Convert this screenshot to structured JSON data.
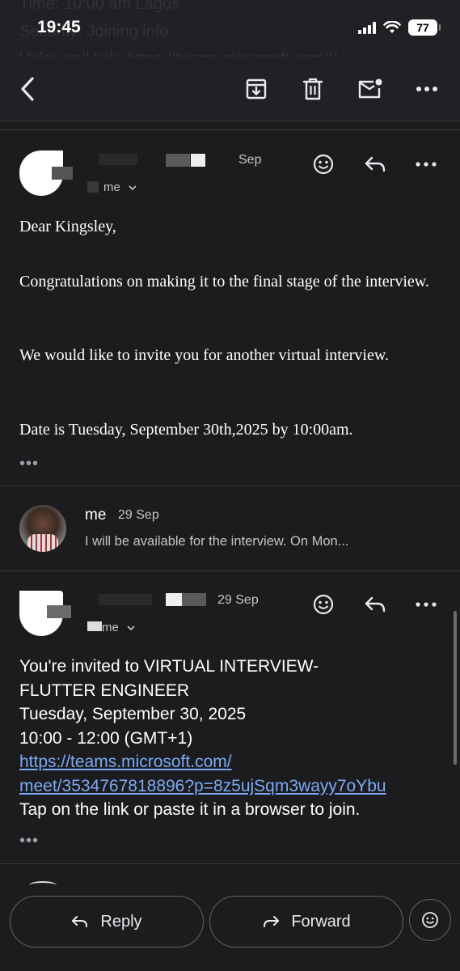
{
  "status_bar": {
    "time": "19:45",
    "battery": "77",
    "ghost_lines": [
      "Time: 10:00 am Lagos",
      "Security: Joining info",
      "Video call link: https://teams.microsoft.com/l/"
    ]
  },
  "toolbar": {
    "icons": [
      "back-arrow-icon",
      "archive-icon",
      "trash-icon",
      "mark-unread-icon",
      "more-icon"
    ]
  },
  "message_1": {
    "date": "Sep",
    "to": "me",
    "greeting": "Dear Kingsley,",
    "paragraph_1": "Congratulations on making it to the final stage of the interview.",
    "paragraph_2": "We would like to invite you for another virtual interview.",
    "paragraph_3": "Date is Tuesday, September 30th,2025 by 10:00am.",
    "more": "•••"
  },
  "message_2": {
    "sender": "me",
    "date": "29 Sep",
    "snippet": "I will be available for the interview. On Mon..."
  },
  "message_3": {
    "date": "29 Sep",
    "to": "me",
    "line_1": "You're invited to VIRTUAL INTERVIEW-",
    "line_2": "FLUTTER ENGINEER",
    "line_3": "Tuesday, September 30, 2025",
    "line_4": "10:00 - 12:00 (GMT+1)",
    "link_line_1": "https://teams.microsoft.com/",
    "link_line_2": "meet/3534767818896?p=8z5ujSqm3wayy7oYbu",
    "line_5": "Tap on the link or paste it in a browser to join.",
    "more": "•••"
  },
  "bottom_bar": {
    "reply_label": "Reply",
    "forward_label": "Forward"
  },
  "colors": {
    "background": "#1c1c1e",
    "link": "#7baaf7",
    "secondary_text": "#c4c4c4"
  }
}
